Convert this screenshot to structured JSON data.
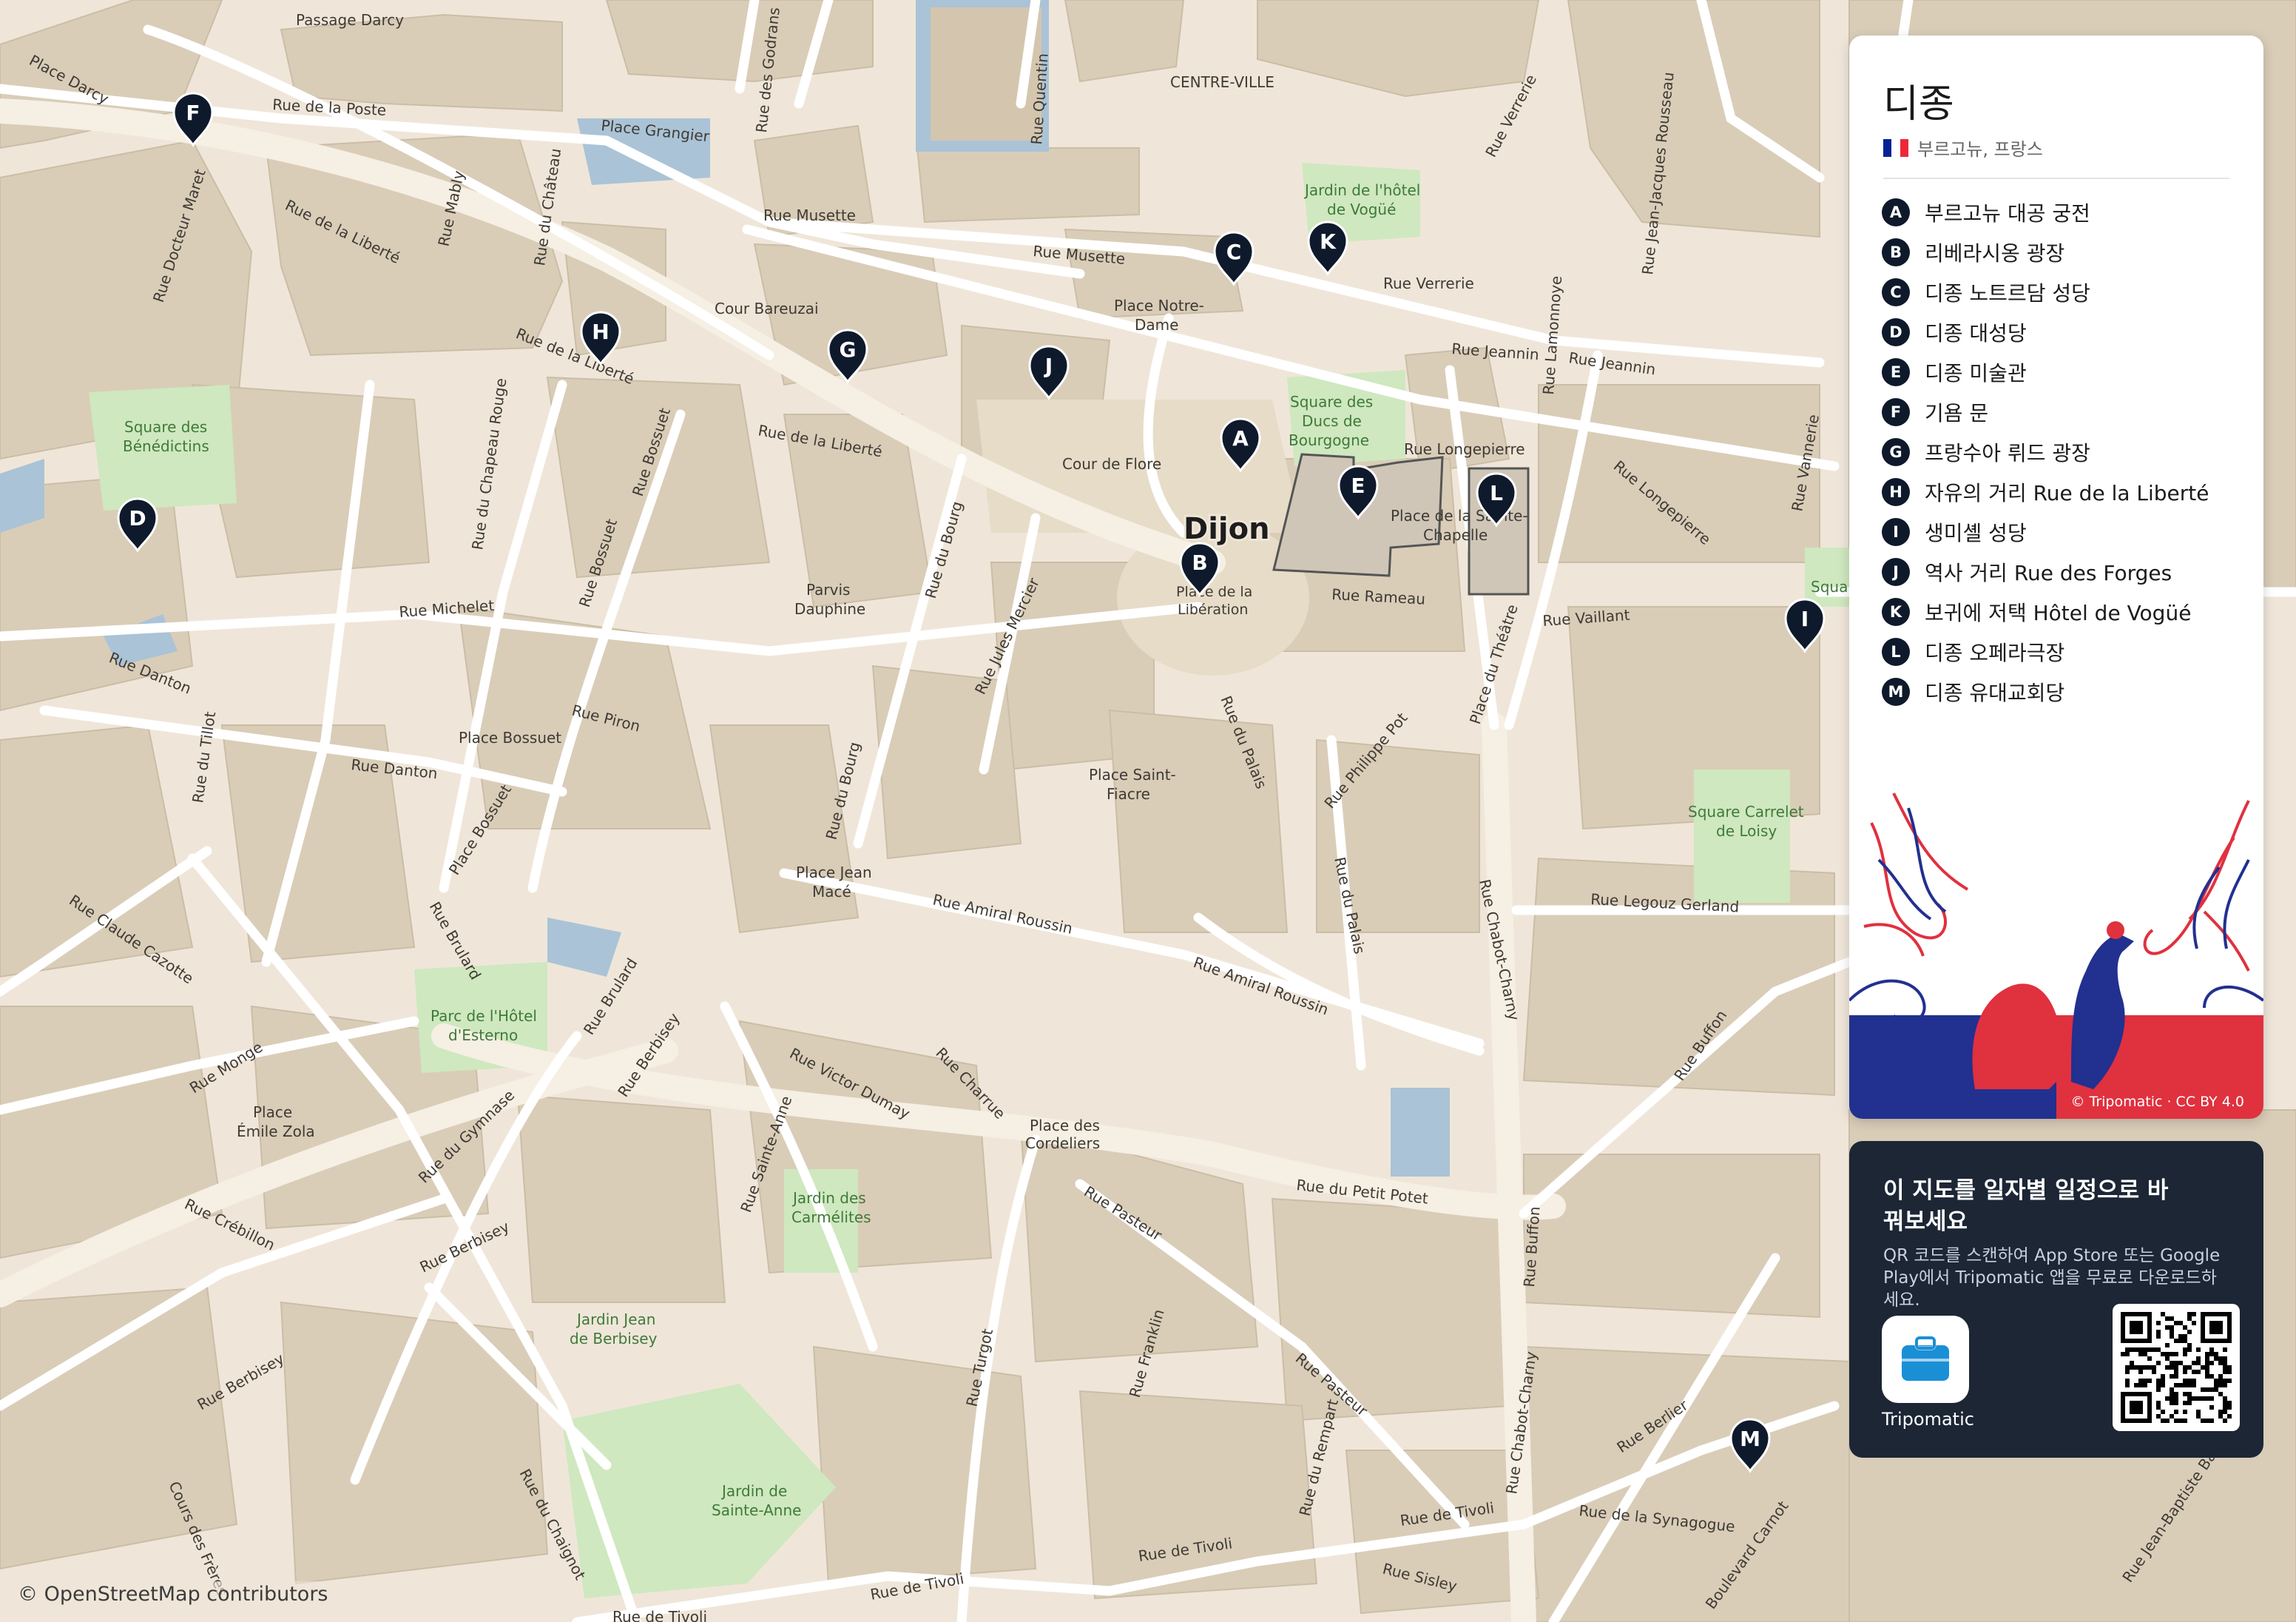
{
  "map": {
    "attribution": "© OpenStreetMap contributors",
    "colors": {
      "land": "#efe6d9",
      "block": "#d9cdb8",
      "road_major": "#f6efe3",
      "road": "#ffffff",
      "park": "#cfe8bf",
      "water": "#aac3d6",
      "pedestrian": "#e6dcc8",
      "pin": "#0e1a2b"
    },
    "city_label": "Dijon",
    "pins": [
      {
        "letter": "A",
        "name": "부르고뉴 대공 궁전"
      },
      {
        "letter": "B",
        "name": "리베라시옹 광장"
      },
      {
        "letter": "C",
        "name": "디종 노트르담 성당"
      },
      {
        "letter": "D",
        "name": "디종 대성당"
      },
      {
        "letter": "E",
        "name": "디종 미술관"
      },
      {
        "letter": "F",
        "name": "기욤 문"
      },
      {
        "letter": "G",
        "name": "프랑수아 뤼드 광장"
      },
      {
        "letter": "H",
        "name": "자유의 거리 Rue de la Liberté"
      },
      {
        "letter": "I",
        "name": "생미셸 성당"
      },
      {
        "letter": "J",
        "name": "역사 거리 Rue des Forges"
      },
      {
        "letter": "K",
        "name": "보귀에 저택 Hôtel de Vogüé"
      },
      {
        "letter": "L",
        "name": "디종 오페라극장"
      },
      {
        "letter": "M",
        "name": "디종 유대교회당"
      }
    ],
    "street_labels": {
      "passage_darcy": "Passage Darcy",
      "place_darcy": "Place Darcy",
      "rue_de_la_poste": "Rue de la Poste",
      "place_grangier": "Place Grangier",
      "rue_des_godrans": "Rue des Godrans",
      "rue_quentin": "Rue Quentin",
      "centre_ville": "CENTRE-VILLE",
      "rue_verrerie_1": "Rue Verrerie",
      "rue_jean_jacques_rousseau": "Rue Jean-Jacques Rousseau",
      "rue_de_la_liberte_1": "Rue de la Liberté",
      "rue_mably": "Rue Mably",
      "rue_du_chateau": "Rue du Château",
      "rue_musette_1": "Rue Musette",
      "rue_musette_2": "Rue Musette",
      "jardin_vogue_1": "Jardin de l'hôtel",
      "jardin_vogue_2": "de Vogüé",
      "rue_verrerie_2": "Rue Verrerie",
      "rue_docteur_maret": "Rue Docteur Maret",
      "cour_bareuzai": "Cour Bareuzai",
      "place_notre_dame_1": "Place Notre-",
      "place_notre_dame_2": "Dame",
      "rue_de_la_liberte_2": "Rue de la Liberté",
      "rue_jeannin_1": "Rue Jeannin",
      "rue_jeannin_2": "Rue Jeannin",
      "rue_lamonnoye": "Rue Lamonnoye",
      "square_ducs_1": "Square des",
      "square_ducs_2": "Ducs de",
      "square_ducs_3": "Bourgogne",
      "rue_longepierre_1": "Rue Longepierre",
      "rue_longepierre_2": "Rue Longepierre",
      "square_benedictins_1": "Square des",
      "square_benedictins_2": "Bénédictins",
      "rue_de_la_liberte_3": "Rue de la Liberté",
      "cour_de_flore": "Cour de Flore",
      "rue_du_chapeau_rouge": "Rue du Chapeau Rouge",
      "rue_bossuet_1": "Rue Bossuet",
      "place_sainte_chapelle_1": "Place de la Sainte-",
      "place_sainte_chapelle_2": "Chapelle",
      "rue_vannerie": "Rue Vannerie",
      "rue_bossuet_2": "Rue Bossuet",
      "rue_du_bourg_1": "Rue du Bourg",
      "parvis_dauphine_1": "Parvis",
      "parvis_dauphine_2": "Dauphine",
      "place_liberation_1": "Place de la",
      "place_liberation_2": "Libération",
      "rue_rameau": "Rue Rameau",
      "rue_michelet": "Rue Michelet",
      "rue_jules_mercier": "Rue Jules Mercier",
      "rue_vaillant": "Rue Vaillant",
      "rue_danton_1": "Rue Danton",
      "place_du_theatre": "Place du Théâtre",
      "rue_piron": "Rue Piron",
      "rue_du_palais_1": "Rue du Palais",
      "rue_du_tillot": "Rue du Tillot",
      "place_bossuet": "Place Bossuet",
      "rue_philippe_pot": "Rue Philippe Pot",
      "rue_danton_2": "Rue Danton",
      "place_saint_fiacre_1": "Place Saint-",
      "place_saint_fiacre_2": "Fiacre",
      "square_carrelet_1": "Square Carrelet",
      "square_carrelet_2": "de Loisy",
      "rue_du_bourg_2": "Rue du Bourg",
      "place_bossuet_rue": "Place Bossuet",
      "place_jean_mace_1": "Place Jean",
      "place_jean_mace_2": "Macé",
      "rue_du_palais_2": "Rue du Palais",
      "rue_legouz_gerland": "Rue Legouz Gerland",
      "rue_claude_cazotte": "Rue Claude Cazotte",
      "rue_amiral_roussin_1": "Rue Amiral Roussin",
      "rue_chabot_charny_1": "Rue Chabot-Charny",
      "rue_brulard_1": "Rue Brulard",
      "rue_amiral_roussin_2": "Rue Amiral Roussin",
      "parc_esterno_1": "Parc de l'Hôtel",
      "parc_esterno_2": "d'Esterno",
      "rue_brulard_2": "Rue Brulard",
      "rue_buffon_1": "Rue Buffon",
      "rue_monge": "Rue Monge",
      "rue_berbisey_1": "Rue Berbisey",
      "rue_victor_dumay": "Rue Victor Dumay",
      "rue_charrue": "Rue Charrue",
      "place_emile_zola_1": "Place",
      "place_emile_zola_2": "Émile Zola",
      "rue_du_gymnase": "Rue du Gymnase",
      "rue_sainte_anne": "Rue Sainte-Anne",
      "place_cordeliers_1": "Place des",
      "place_cordeliers_2": "Cordeliers",
      "rue_du_petit_potet": "Rue du Petit Potet",
      "jardin_carmelites_1": "Jardin des",
      "jardin_carmelites_2": "Carmélites",
      "rue_crebillon": "Rue Crébillon",
      "rue_berbisey_2": "Rue Berbisey",
      "rue_pasteur_1": "Rue Pasteur",
      "rue_buffon_2": "Rue Buffon",
      "jardin_berbisey_1": "Jardin Jean",
      "jardin_berbisey_2": "de Berbisey",
      "rue_turgot": "Rue Turgot",
      "rue_franklin": "Rue Franklin",
      "rue_pasteur_2": "Rue Pasteur",
      "rue_berbisey_3": "Rue Berbisey",
      "rue_du_rempart": "Rue du Rempart",
      "rue_chabot_charny_2": "Rue Chabot-Charny",
      "rue_berlier": "Rue Berlier",
      "jardin_sainte_anne_1": "Jardin de",
      "jardin_sainte_anne_2": "Sainte-Anne",
      "rue_du_chaignot": "Rue du Chaignot",
      "cours_des_freres": "Cours des Frères",
      "rue_de_tivoli_1": "Rue de Tivoli",
      "rue_de_la_synagogue": "Rue de la Synagogue",
      "rue_de_tivoli_2": "Rue de Tivoli",
      "rue_de_tivoli_3": "Rue de Tivoli",
      "rue_de_tivoli_4": "Rue de Tivoli",
      "rue_sisley": "Rue Sisley",
      "boulevard_carnot": "Boulevard Carnot",
      "rue_jean_baptiste_baudin": "Rue Jean-Baptiste Baudin",
      "square_edge": "Squa"
    }
  },
  "panel": {
    "title": "디종",
    "region": "부르고뉴, 프랑스",
    "flag_colors": [
      "#002395",
      "#ffffff",
      "#ed2939"
    ],
    "art_colors": {
      "blue": "#22308f",
      "red": "#e0313f"
    },
    "credit": "© Tripomatic · CC BY 4.0"
  },
  "qr_card": {
    "headline": "이 지도를 일자별 일정으로 바꿔보세요",
    "description": "QR 코드를 스캔하여 App Store 또는 Google Play에서 Tripomatic 앱을 무료로 다운로드하세요.",
    "app_name": "Tripomatic",
    "app_icon": "suitcase-icon",
    "accent": "#1b8fd6"
  }
}
